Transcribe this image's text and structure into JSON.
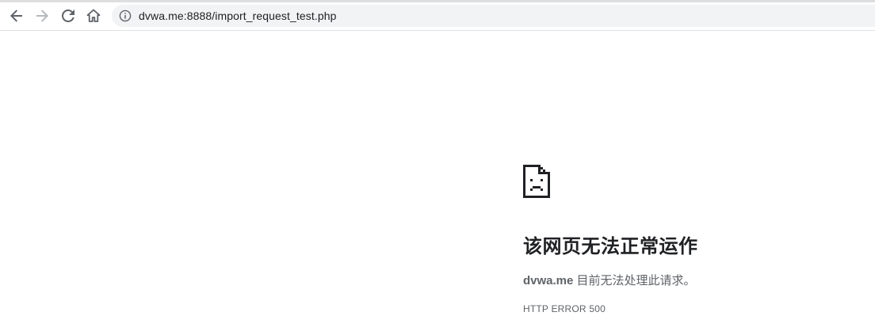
{
  "browser": {
    "url": "dvwa.me:8888/import_request_test.php",
    "icons": {
      "back": "arrow-left-icon",
      "forward": "arrow-right-icon",
      "reload": "reload-icon",
      "home": "home-icon",
      "site_info": "info-circle-icon"
    },
    "icon_color": "#5f6368",
    "forward_disabled_color": "#b6b9bc",
    "omnibox_color": "#f1f3f4"
  },
  "error_page": {
    "icon": "sad-page-icon",
    "title": "该网页无法正常运作",
    "host": "dvwa.me",
    "message": " 目前无法处理此请求。",
    "code": "HTTP ERROR 500",
    "text_color": "#202124",
    "secondary_color": "#5f6368"
  }
}
